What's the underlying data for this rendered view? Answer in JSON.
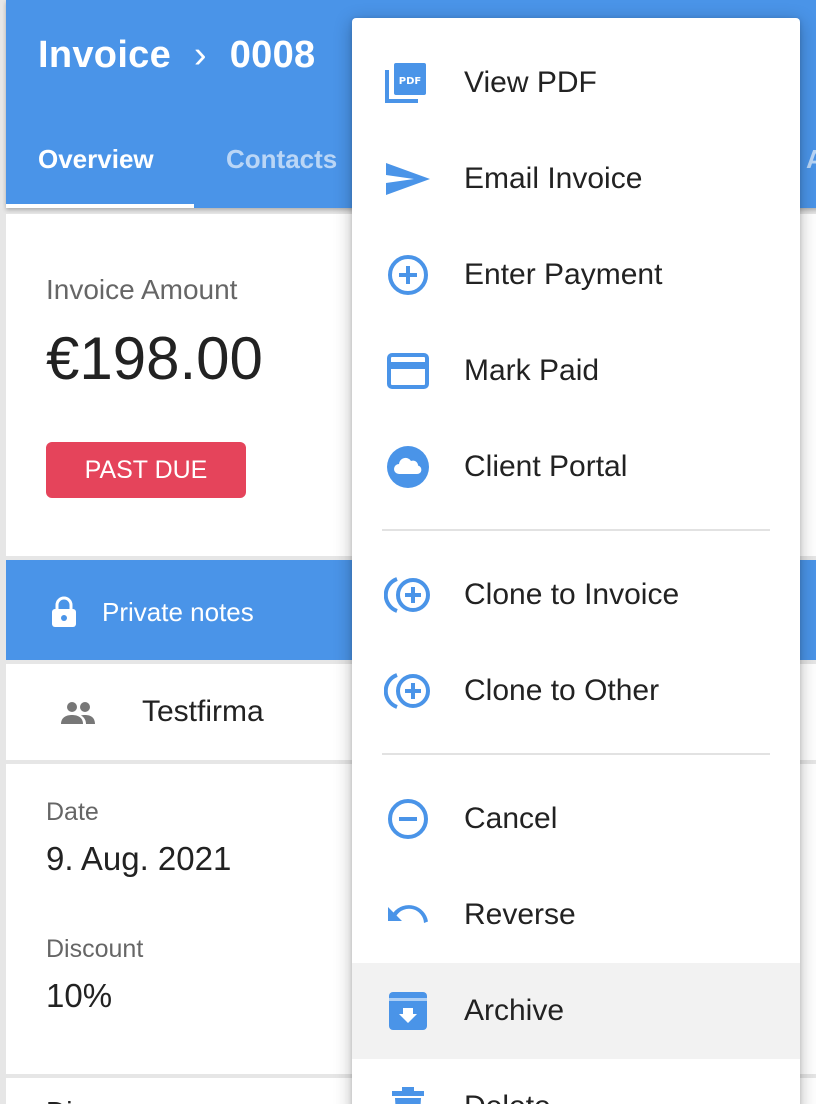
{
  "header": {
    "breadcrumb_root": "Invoice",
    "separator": "›",
    "invoice_number": "0008",
    "tabs": [
      {
        "label": "Overview",
        "active": true
      },
      {
        "label": "Contacts",
        "active": false
      },
      {
        "label": "Ac",
        "active": false
      }
    ]
  },
  "summary": {
    "amount_label": "Invoice Amount",
    "amount": "€198.00",
    "status": "PAST DUE"
  },
  "private_notes": {
    "label": "Private notes",
    "icon": "lock-icon"
  },
  "client": {
    "name": "Testfirma",
    "icon": "people-icon"
  },
  "details": [
    {
      "label": "Date",
      "value": "9. Aug. 2021"
    },
    {
      "label": "Discount",
      "value": "10%"
    }
  ],
  "bottom_partial_text": "Di",
  "menu": {
    "items": [
      {
        "label": "View PDF",
        "icon": "pdf-icon"
      },
      {
        "label": "Email Invoice",
        "icon": "send-icon"
      },
      {
        "label": "Enter Payment",
        "icon": "add-circle-icon"
      },
      {
        "label": "Mark Paid",
        "icon": "credit-card-icon"
      },
      {
        "label": "Client Portal",
        "icon": "cloud-icon"
      },
      {
        "label": "Clone to Invoice",
        "icon": "clone-icon"
      },
      {
        "label": "Clone to Other",
        "icon": "clone-icon"
      },
      {
        "label": "Cancel",
        "icon": "remove-circle-icon"
      },
      {
        "label": "Reverse",
        "icon": "undo-icon"
      },
      {
        "label": "Archive",
        "icon": "archive-icon",
        "highlighted": true
      },
      {
        "label": "Delete",
        "icon": "trash-icon"
      }
    ]
  },
  "colors": {
    "primary": "#4a94e8",
    "danger": "#e5445b",
    "icon_blue": "#4a94e8",
    "menu_highlight": "#f2f2f2"
  }
}
